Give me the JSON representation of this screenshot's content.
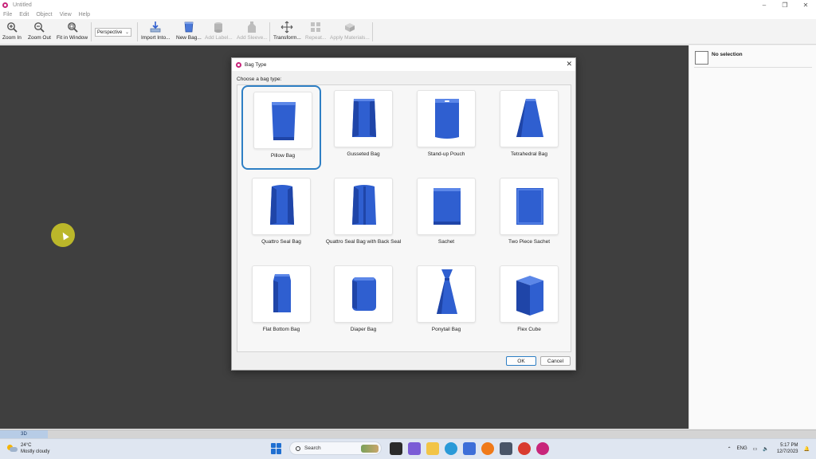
{
  "window": {
    "title": "Untitled",
    "controls": [
      "–",
      "❐",
      "✕"
    ]
  },
  "menu": [
    "File",
    "Edit",
    "Object",
    "View",
    "Help"
  ],
  "toolbar": {
    "zoom_in": "Zoom In",
    "zoom_out": "Zoom Out",
    "fit_in_window": "Fit in Window",
    "view_mode": "Perspective",
    "import_into": "Import Into...",
    "new_bag": "New Bag...",
    "add_label": "Add Label...",
    "add_sleeve": "Add Sleeve...",
    "transform": "Transform...",
    "repeat": "Repeat...",
    "apply_materials": "Apply Materials..."
  },
  "right_panel": {
    "selection": "No selection"
  },
  "view_tab": "3D",
  "dialog": {
    "title": "Bag Type",
    "prompt": "Choose a bag type:",
    "selected": "Pillow Bag",
    "ok": "OK",
    "cancel": "Cancel",
    "bag_types": [
      {
        "label": "Pillow Bag",
        "icon": "pillow-bag-icon"
      },
      {
        "label": "Gusseted Bag",
        "icon": "gusseted-bag-icon"
      },
      {
        "label": "Stand-up Pouch",
        "icon": "stand-up-pouch-icon"
      },
      {
        "label": "Tetrahedral Bag",
        "icon": "tetrahedral-bag-icon"
      },
      {
        "label": "Quattro Seal Bag",
        "icon": "quattro-seal-bag-icon"
      },
      {
        "label": "Quattro Seal Bag with Back Seal",
        "icon": "quattro-back-seal-bag-icon"
      },
      {
        "label": "Sachet",
        "icon": "sachet-icon"
      },
      {
        "label": "Two Piece Sachet",
        "icon": "two-piece-sachet-icon"
      },
      {
        "label": "Flat Bottom Bag",
        "icon": "flat-bottom-bag-icon"
      },
      {
        "label": "Diaper Bag",
        "icon": "diaper-bag-icon"
      },
      {
        "label": "Ponytail Bag",
        "icon": "ponytail-bag-icon"
      },
      {
        "label": "Flex Cube",
        "icon": "flex-cube-icon"
      }
    ]
  },
  "taskbar": {
    "temperature": "24°C",
    "weather": "Mostly cloudy",
    "search_placeholder": "Search",
    "language": "ENG",
    "time": "5:17 PM",
    "date": "12/7/2023"
  },
  "colors": {
    "bag_blue": "#2f5fd0",
    "accent": "#2e7fc4",
    "canvas": "#3f3f3f",
    "brand": "#c8257a"
  }
}
